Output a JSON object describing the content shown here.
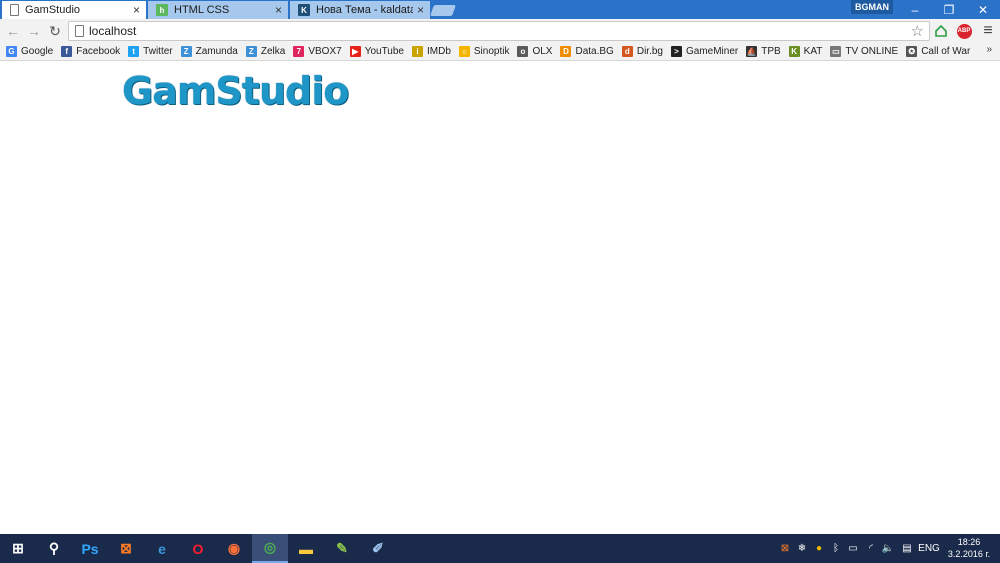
{
  "tabs": [
    {
      "title": "GamStudio",
      "active": true,
      "icon": "page-icon"
    },
    {
      "title": "HTML CSS",
      "active": false,
      "icon": "html-css-icon"
    },
    {
      "title": "Нова Тема - kaldata.com",
      "active": false,
      "icon": "kaldata-icon"
    }
  ],
  "user_badge": "BGMAN",
  "window_controls": {
    "minimize": "–",
    "restore": "❐",
    "close": "✕"
  },
  "toolbar": {
    "url": "localhost",
    "back_icon": "←",
    "forward_icon": "→",
    "reload_icon": "↻",
    "star_icon": "☆",
    "menu_icon": "≡",
    "abp_label": "ABP"
  },
  "bookmarks": [
    {
      "label": "Google",
      "icon": "google-icon",
      "color": "#4285f4",
      "glyph": "G"
    },
    {
      "label": "Facebook",
      "icon": "facebook-icon",
      "color": "#3b5998",
      "glyph": "f"
    },
    {
      "label": "Twitter",
      "icon": "twitter-icon",
      "color": "#1da1f2",
      "glyph": "t"
    },
    {
      "label": "Zamunda",
      "icon": "zamunda-icon",
      "color": "#3d8fd6",
      "glyph": "Z"
    },
    {
      "label": "Zelka",
      "icon": "zelka-icon",
      "color": "#3d8fd6",
      "glyph": "Z"
    },
    {
      "label": "VBOX7",
      "icon": "vbox7-icon",
      "color": "#e0245e",
      "glyph": "7"
    },
    {
      "label": "YouTube",
      "icon": "youtube-icon",
      "color": "#e62117",
      "glyph": "▶"
    },
    {
      "label": "IMDb",
      "icon": "imdb-icon",
      "color": "#c9a400",
      "glyph": "i"
    },
    {
      "label": "Sinoptik",
      "icon": "sinoptik-icon",
      "color": "#f4b400",
      "glyph": "☼"
    },
    {
      "label": "OLX",
      "icon": "olx-icon",
      "color": "#5a5a5a",
      "glyph": "o"
    },
    {
      "label": "Data.BG",
      "icon": "databg-icon",
      "color": "#f08c00",
      "glyph": "D"
    },
    {
      "label": "Dir.bg",
      "icon": "dirbg-icon",
      "color": "#d4571f",
      "glyph": "d"
    },
    {
      "label": "GameMiner",
      "icon": "gameminer-icon",
      "color": "#222222",
      "glyph": ">"
    },
    {
      "label": "TPB",
      "icon": "tpb-icon",
      "color": "#333333",
      "glyph": "⛵"
    },
    {
      "label": "KAT",
      "icon": "kat-icon",
      "color": "#6b8e23",
      "glyph": "K"
    },
    {
      "label": "TV ONLINE",
      "icon": "tv-online-icon",
      "color": "#777777",
      "glyph": "▭"
    },
    {
      "label": "Call of War",
      "icon": "call-of-war-icon",
      "color": "#555555",
      "glyph": "✪"
    }
  ],
  "bookmarks_more": "»",
  "page": {
    "logo_text": "GamStudio"
  },
  "taskbar": {
    "items": [
      {
        "name": "start-button",
        "glyph": "⊞",
        "color": "#ffffff",
        "active": false
      },
      {
        "name": "search-button",
        "glyph": "⚲",
        "color": "#ffffff",
        "active": false
      },
      {
        "name": "photoshop-app",
        "glyph": "Ps",
        "color": "#31a8ff",
        "active": false
      },
      {
        "name": "xampp-app",
        "glyph": "⊠",
        "color": "#fb7a24",
        "active": false
      },
      {
        "name": "edge-app",
        "glyph": "e",
        "color": "#3a96dd",
        "active": false
      },
      {
        "name": "opera-app",
        "glyph": "O",
        "color": "#ff1b2d",
        "active": false
      },
      {
        "name": "firefox-app",
        "glyph": "◉",
        "color": "#ff7139",
        "active": false
      },
      {
        "name": "chrome-app",
        "glyph": "◎",
        "color": "#4caf50",
        "active": true
      },
      {
        "name": "file-explorer-app",
        "glyph": "▬",
        "color": "#f8c93d",
        "active": false
      },
      {
        "name": "notepadpp-app",
        "glyph": "✎",
        "color": "#8bc34a",
        "active": false
      },
      {
        "name": "paint-app",
        "glyph": "✐",
        "color": "#9ec5f0",
        "active": false
      }
    ],
    "tray": {
      "lang": "ENG",
      "time": "18:26",
      "date": "3.2.2016 г."
    }
  }
}
